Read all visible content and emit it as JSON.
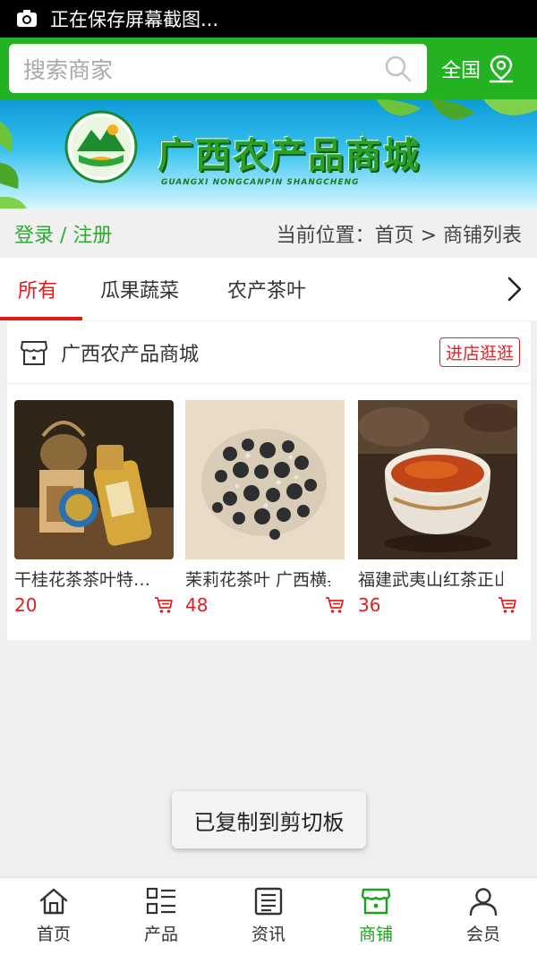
{
  "status_bar": {
    "text": "正在保存屏幕截图...",
    "icon": "screenshot-icon"
  },
  "search": {
    "placeholder": "搜索商家",
    "icon": "search-icon"
  },
  "region": {
    "label": "全国",
    "icon": "location-icon"
  },
  "banner": {
    "title": "广西农产品商城",
    "pinyin": "GUANGXI NONGCANPIN SHANGCHENG"
  },
  "location_bar": {
    "login_label": "登录 / 注册",
    "breadcrumb": "当前位置：首页 > 商铺列表"
  },
  "tabs": [
    {
      "label": "所有",
      "active": true
    },
    {
      "label": "瓜果蔬菜",
      "active": false
    },
    {
      "label": "农产茶叶",
      "active": false
    }
  ],
  "shop": {
    "name": "广西农产品商城",
    "enter_label": "进店逛逛",
    "products": [
      {
        "name": "干桂花茶茶叶特级新花",
        "price": "20"
      },
      {
        "name": "茉莉花茶叶 广西横县",
        "price": "48"
      },
      {
        "name": "福建武夷山红茶正山小种",
        "price": "36"
      }
    ]
  },
  "toast": {
    "text": "已复制到剪切板"
  },
  "bottom_nav": [
    {
      "label": "首页",
      "icon": "home-icon",
      "active": false
    },
    {
      "label": "产品",
      "icon": "product-list-icon",
      "active": false
    },
    {
      "label": "资讯",
      "icon": "news-icon",
      "active": false
    },
    {
      "label": "商铺",
      "icon": "shop-icon",
      "active": true
    },
    {
      "label": "会员",
      "icon": "member-icon",
      "active": false
    }
  ],
  "colors": {
    "primary_green": "#22b222",
    "accent_red": "#e01b1b",
    "price_red": "#e02020"
  }
}
